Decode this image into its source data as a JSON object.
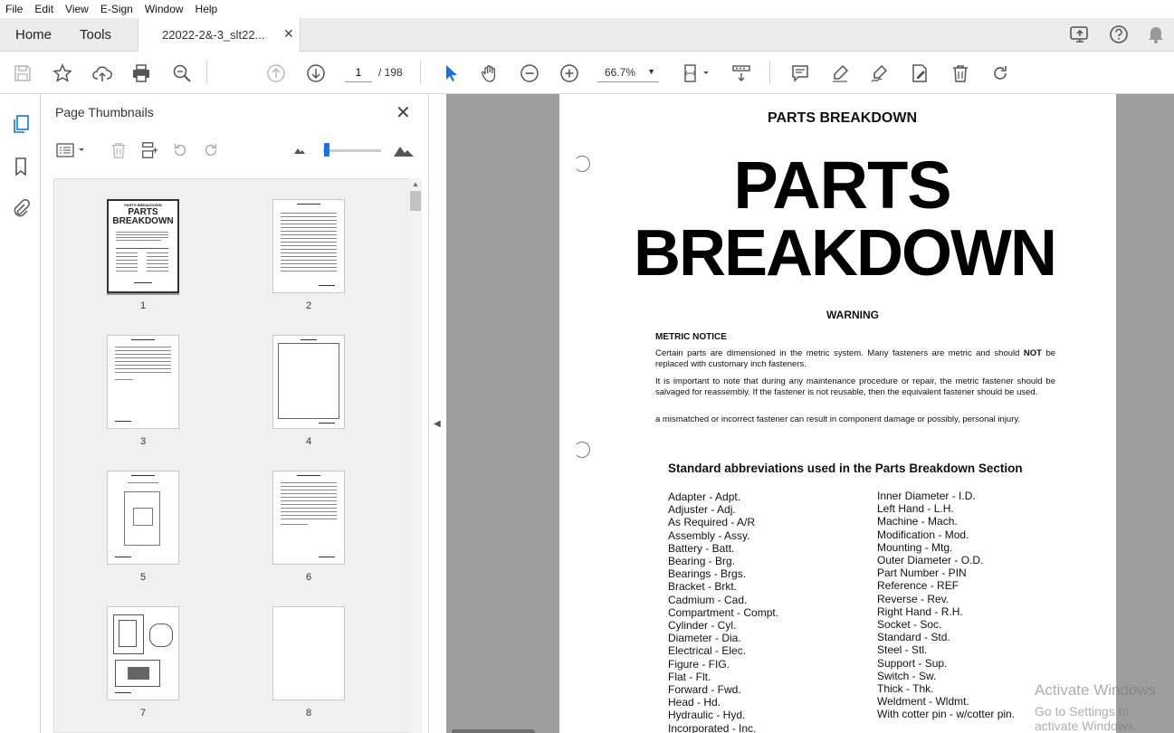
{
  "menu": [
    "File",
    "Edit",
    "View",
    "E-Sign",
    "Window",
    "Help"
  ],
  "tabs": {
    "home": "Home",
    "tools": "Tools",
    "document": "22022-2&-3_slt22...",
    "close": "✕"
  },
  "toolbar": {
    "page_current": "1",
    "page_total": "/ 198",
    "zoom": "66.7%"
  },
  "panel": {
    "title": "Page Thumbnails",
    "close": "✕"
  },
  "thumbnails": [
    "1",
    "2",
    "3",
    "4",
    "5",
    "6",
    "7",
    "8"
  ],
  "document": {
    "header": "PARTS BREAKDOWN",
    "big_line1": "PARTS",
    "big_line2": "BREAKDOWN",
    "warning": "WARNING",
    "metric_title": "METRIC NOTICE",
    "para1a": "Certain parts are dimensioned in the metric system. Many fasteners are metric and should",
    "para1b": "NOT",
    "para1c": "be replaced with customary inch fasteners.",
    "para2": "It is important to note that during any maintenance procedure or repair, the metric fastener should be salvaged for reassembly. If the fastener is not reusable, then the equivalent fastener should be used.",
    "para3": "a mismatched or incorrect fastener can result in component damage or possibly, personal injury.",
    "std_title": "Standard abbreviations used in the Parts Breakdown Section",
    "abbr_left": [
      "Adapter - Adpt.",
      "Adjuster - Adj.",
      "As Required - A/R",
      "Assembly - Assy.",
      "Battery - Batt.",
      "Bearing - Brg.",
      "Bearings - Brgs.",
      "Bracket - Brkt.",
      "Cadmium - Cad.",
      "Compartment - Compt.",
      "Cylinder - Cyl.",
      "Diameter - Dia.",
      "Electrical - Elec.",
      "Figure - FIG.",
      "Flat - Flt.",
      "Forward - Fwd.",
      "Head - Hd.",
      "Hydraulic - Hyd.",
      "Incorporated - Inc."
    ],
    "abbr_right": [
      "Inner Diameter - I.D.",
      "Left Hand - L.H.",
      "Machine - Mach.",
      "Modification - Mod.",
      "Mounting - Mtg.",
      "Outer Diameter - O.D.",
      "Part Number - PIN",
      "Reference - REF",
      "Reverse - Rev.",
      "Right Hand - R.H.",
      "Socket - Soc.",
      "Standard - Std.",
      "Steel - Stl.",
      "Support - Sup.",
      "Switch - Sw.",
      "Thick - Thk.",
      "Weldment - Wldmt.",
      "With cotter pin - w/cotter pin."
    ]
  },
  "watermark": {
    "line1": "Activate Windows",
    "line2": "Go to Settings to activate Windows."
  },
  "colors": {
    "accent": "#1473e6",
    "doc_bg": "#9e9e9e"
  }
}
